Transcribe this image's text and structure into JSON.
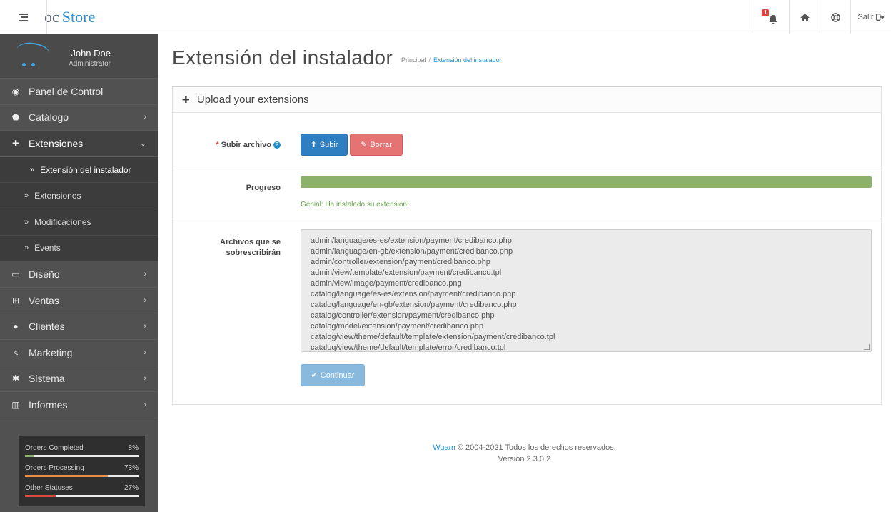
{
  "header": {
    "logo_oc": "oc",
    "logo_store": "Store",
    "notification_count": "1",
    "logout_label": "Salir"
  },
  "sidebar": {
    "profile": {
      "name": "John Doe",
      "role": "Administrator"
    },
    "items": [
      {
        "label": "Panel de Control",
        "icon": "dashboard-icon"
      },
      {
        "label": "Catálogo",
        "icon": "tag-icon"
      },
      {
        "label": "Extensiones",
        "icon": "puzzle-icon"
      },
      {
        "label": "Diseño",
        "icon": "monitor-icon"
      },
      {
        "label": "Ventas",
        "icon": "cart-icon"
      },
      {
        "label": "Clientes",
        "icon": "user-icon"
      },
      {
        "label": "Marketing",
        "icon": "share-icon"
      },
      {
        "label": "Sistema",
        "icon": "cog-icon"
      },
      {
        "label": "Informes",
        "icon": "bar-chart-icon"
      }
    ],
    "subitems": [
      {
        "label": "Extensión del instalador"
      },
      {
        "label": "Extensiones"
      },
      {
        "label": "Modificaciones"
      },
      {
        "label": "Events"
      }
    ],
    "stats": [
      {
        "label": "Orders Completed",
        "percent": "8%",
        "value": 0.08,
        "color": "#8cb16a"
      },
      {
        "label": "Orders Processing",
        "percent": "73%",
        "value": 0.73,
        "color": "#e8914a"
      },
      {
        "label": "Other Statuses",
        "percent": "27%",
        "value": 0.27,
        "color": "#e0483d"
      }
    ]
  },
  "page": {
    "title": "Extensión del instalador",
    "breadcrumb": [
      "Principal",
      "Extensión del instalador"
    ]
  },
  "panel": {
    "heading": "Upload your extensions",
    "upload_label": "Subir archivo",
    "upload_button": "Subir",
    "clear_button": "Borrar",
    "progress_label": "Progreso",
    "progress_value": 1.0,
    "progress_message": "Genial: Ha instalado su extensión!",
    "overwrite_label_1": "Archivos que se",
    "overwrite_label_2": "sobrescribirán",
    "files": [
      "admin/language/es-es/extension/payment/credibanco.php",
      "admin/language/en-gb/extension/payment/credibanco.php",
      "admin/controller/extension/payment/credibanco.php",
      "admin/view/template/extension/payment/credibanco.tpl",
      "admin/view/image/payment/credibanco.png",
      "catalog/language/es-es/extension/payment/credibanco.php",
      "catalog/language/en-gb/extension/payment/credibanco.php",
      "catalog/controller/extension/payment/credibanco.php",
      "catalog/model/extension/payment/credibanco.php",
      "catalog/view/theme/default/template/extension/payment/credibanco.tpl",
      "catalog/view/theme/default/template/error/credibanco.tpl"
    ],
    "continue_button": "Continuar"
  },
  "footer": {
    "brand": "Wuam",
    "copyright": "© 2004-2021 Todos los derechos reservados.",
    "version": "Versión 2.3.0.2"
  }
}
